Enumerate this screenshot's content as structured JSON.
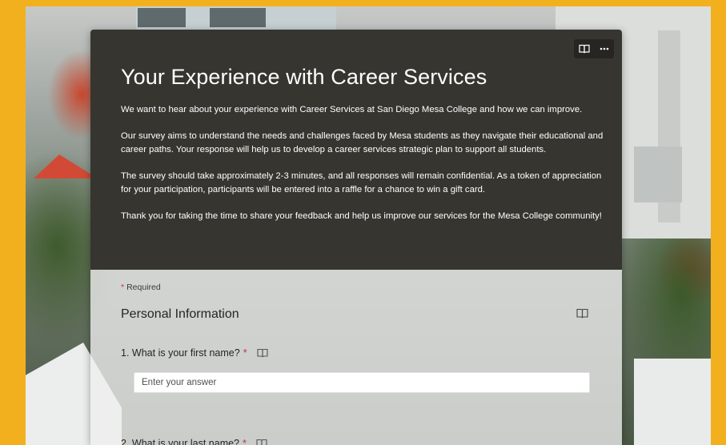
{
  "form": {
    "title": "Your Experience with Career Services",
    "description": [
      "We want to hear about your experience with Career Services at San Diego Mesa College and how we can improve.",
      "Our survey aims to understand the needs and challenges faced by Mesa students as they navigate their educational and career paths. Your response will help us to develop a career services strategic plan to support all students.",
      "The survey should take approximately 2-3 minutes, and all responses will remain confidential. As a token of appreciation for your participation, participants will be entered into a raffle for a chance to win a gift card.",
      "Thank you for taking the time to share your feedback and help us improve our services for the Mesa College community!"
    ],
    "header_icons": [
      "immersive-reader-icon",
      "more-options-icon"
    ]
  },
  "body": {
    "required_label": "Required",
    "required_star": "*",
    "section_title": "Personal Information",
    "questions": [
      {
        "number": "1.",
        "label": "What is your first name?",
        "star": "*",
        "placeholder": "Enter your answer"
      },
      {
        "number": "2.",
        "label": "What is your last name?",
        "star": "*"
      }
    ]
  },
  "colors": {
    "page_background": "#f2b01e",
    "header_background": "#363530",
    "required_star": "#c4314b"
  }
}
